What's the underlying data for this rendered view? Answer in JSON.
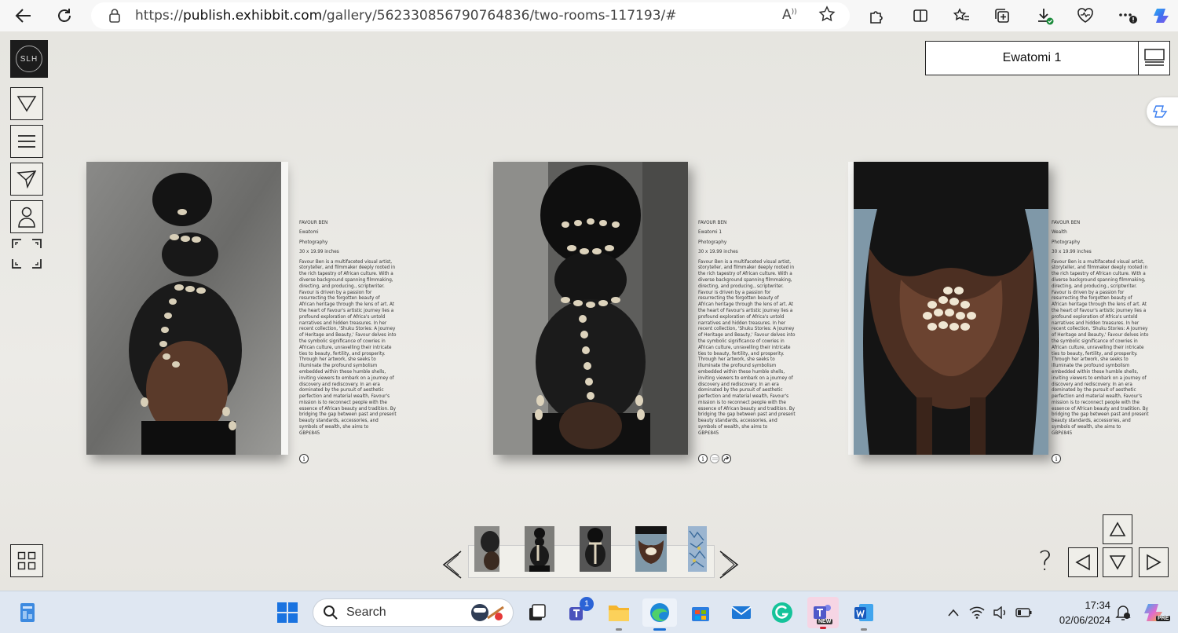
{
  "browser": {
    "url_prefix": "https://",
    "url_domain": "publish.exhibbit.com",
    "url_path": "/gallery/562330856790764836/two-rooms-117193/#"
  },
  "viewer": {
    "logo_text": "SLH",
    "title": "Ewatomi 1",
    "sidebar_icons": [
      "triangle-down-icon",
      "list-icon",
      "send-icon",
      "person-icon",
      "fullscreen-icon"
    ],
    "grid_icon": "grid-icon"
  },
  "artworks": [
    {
      "artist": "FAVOUR BEN",
      "title": "Ewatomi",
      "medium": "Photography",
      "size": "30 x 19.99 inches",
      "description": "Favour Ben is a multifaceted visual artist, storyteller, and filmmaker deeply rooted in the rich tapestry of African culture. With a diverse background spanning filmmaking, directing, and producing., scriptwriter. Favour is driven by a passion for resurrecting the forgotten beauty of African heritage through the lens of art. At the heart of Favour's artistic journey lies a profound exploration of Africa's untold narratives and hidden treasures. In her recent collection, 'Shuku Stories: A Journey of Heritage and Beauty,' Favour delves into the symbolic significance of cowries in African culture, unravelling their intricate ties to beauty, fertility, and prosperity. Through her artwork, she seeks to illuminate the profound symbolism embedded within these humble shells, inviting viewers to embark on a journey of discovery and rediscovery. In an era dominated by the pursuit of aesthetic perfection and material wealth, Favour's mission is to reconnect people with the essence of African beauty and tradition. By bridging the gap between past and present beauty standards, accessories, and symbols of wealth, she aims to",
      "price": "GBP£845"
    },
    {
      "artist": "FAVOUR BEN",
      "title": "Ewatomi 1",
      "medium": "Photography",
      "size": "30 x 19.99 inches",
      "description": "Favour Ben is a multifaceted visual artist, storyteller, and filmmaker deeply rooted in the rich tapestry of African culture. With a diverse background spanning filmmaking, directing, and producing., scriptwriter. Favour is driven by a passion for resurrecting the forgotten beauty of African heritage through the lens of art. At the heart of Favour's artistic journey lies a profound exploration of Africa's untold narratives and hidden treasures. In her recent collection, 'Shuku Stories: A Journey of Heritage and Beauty,' Favour delves into the symbolic significance of cowries in African culture, unravelling their intricate ties to beauty, fertility, and prosperity. Through her artwork, she seeks to illuminate the profound symbolism embedded within these humble shells, inviting viewers to embark on a journey of discovery and rediscovery. In an era dominated by the pursuit of aesthetic perfection and material wealth, Favour's mission is to reconnect people with the essence of African beauty and tradition. By bridging the gap between past and present beauty standards, accessories, and symbols of wealth, she aims to",
      "price": "GBP£845"
    },
    {
      "artist": "FAVOUR BEN",
      "title": "Wealth",
      "medium": "Photography",
      "size": "30 x 19.99 inches",
      "description": "Favour Ben is a multifaceted visual artist, storyteller, and filmmaker deeply rooted in the rich tapestry of African culture. With a diverse background spanning filmmaking, directing, and producing., scriptwriter. Favour is driven by a passion for resurrecting the forgotten beauty of African heritage through the lens of art. At the heart of Favour's artistic journey lies a profound exploration of Africa's untold narratives and hidden treasures. In her recent collection, 'Shuku Stories: A Journey of Heritage and Beauty,' Favour delves into the symbolic significance of cowries in African culture, unravelling their intricate ties to beauty, fertility, and prosperity. Through her artwork, she seeks to illuminate the profound symbolism embedded within these humble shells, inviting viewers to embark on a journey of discovery and rediscovery. In an era dominated by the pursuit of aesthetic perfection and material wealth, Favour's mission is to reconnect people with the essence of African beauty and tradition. By bridging the gap between past and present beauty standards, accessories, and symbols of wealth, she aims to",
      "price": "GBP£845"
    }
  ],
  "controls": {
    "help": "?"
  },
  "taskbar": {
    "search_placeholder": "Search",
    "teams_badge": "1",
    "teams_new_badge": "NEW",
    "copilot_badge": "PRE",
    "time": "17:34",
    "date": "02/06/2024"
  },
  "colors": {
    "viewer_bg": "#e8e6e1",
    "taskbar_bg": "#dfe7f2",
    "frame_border": "#222222"
  }
}
